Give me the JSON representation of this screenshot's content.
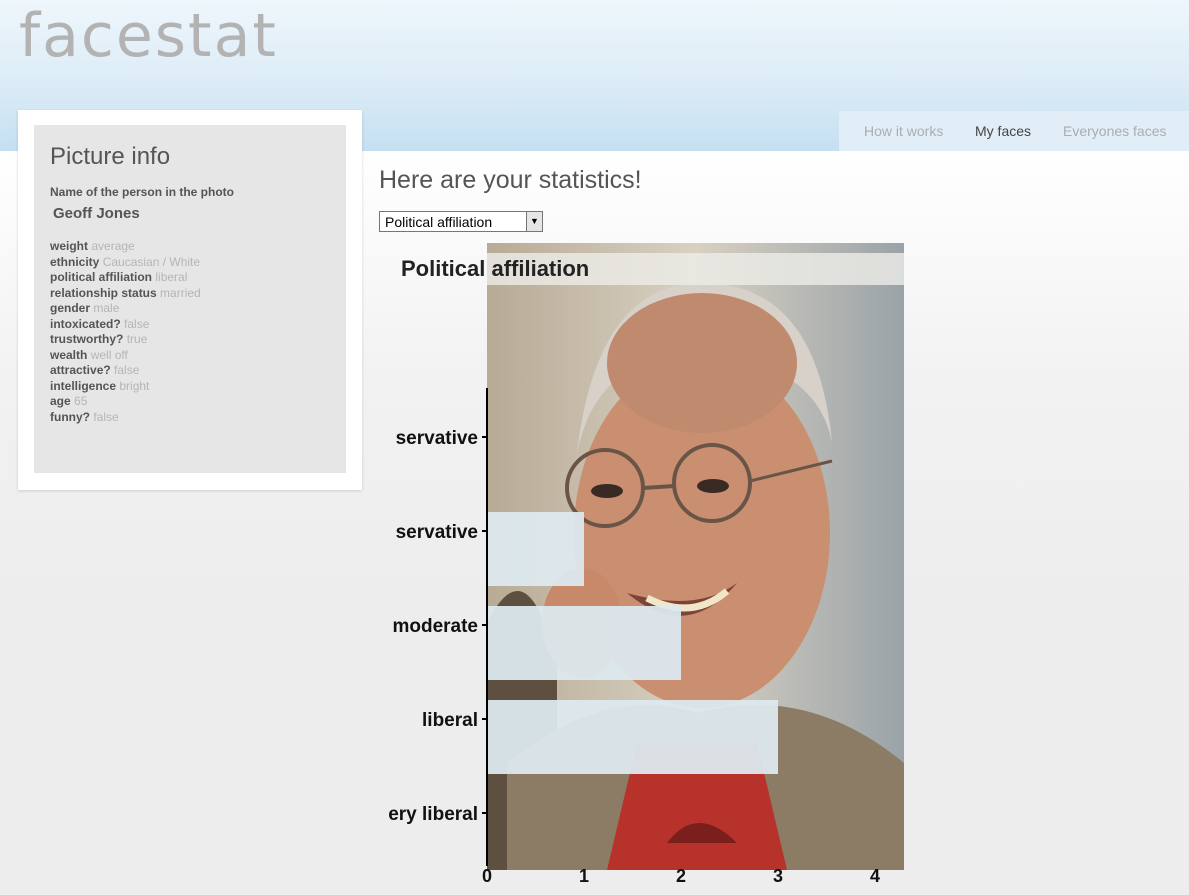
{
  "app": {
    "logo": "facestat"
  },
  "nav": [
    {
      "label": "How it works",
      "active": false
    },
    {
      "label": "My faces",
      "active": true
    },
    {
      "label": "Everyones faces",
      "active": false
    }
  ],
  "panel": {
    "title": "Picture info",
    "name_label": "Name of the person in the photo",
    "name_value": "Geoff Jones",
    "attributes": [
      {
        "key": "weight",
        "value": "average"
      },
      {
        "key": "ethnicity",
        "value": "Caucasian / White"
      },
      {
        "key": "political affiliation",
        "value": "liberal"
      },
      {
        "key": "relationship status",
        "value": "married"
      },
      {
        "key": "gender",
        "value": "male"
      },
      {
        "key": "intoxicated?",
        "value": "false"
      },
      {
        "key": "trustworthy?",
        "value": "true"
      },
      {
        "key": "wealth",
        "value": "well off"
      },
      {
        "key": "attractive?",
        "value": "false"
      },
      {
        "key": "intelligence",
        "value": "bright"
      },
      {
        "key": "age",
        "value": "65"
      },
      {
        "key": "funny?",
        "value": "false"
      }
    ]
  },
  "main": {
    "title": "Here are your statistics!",
    "select": {
      "selected": "Political affiliation"
    }
  },
  "chart_data": {
    "type": "bar",
    "orientation": "horizontal",
    "title": "Political affiliation",
    "categories": [
      "servative",
      "servative",
      "moderate",
      "liberal",
      "ery liberal"
    ],
    "values": [
      0,
      1,
      2,
      3,
      0
    ],
    "xlim": [
      0,
      4
    ],
    "xticks": [
      "0",
      "1",
      "2",
      "3",
      "4"
    ],
    "grid": false,
    "bar_color": "#dde9ef",
    "background": "photo"
  },
  "colors": {
    "header_top": "#eef6fb",
    "header_bottom": "#c5dff0",
    "logo": "#b3b3b3"
  }
}
